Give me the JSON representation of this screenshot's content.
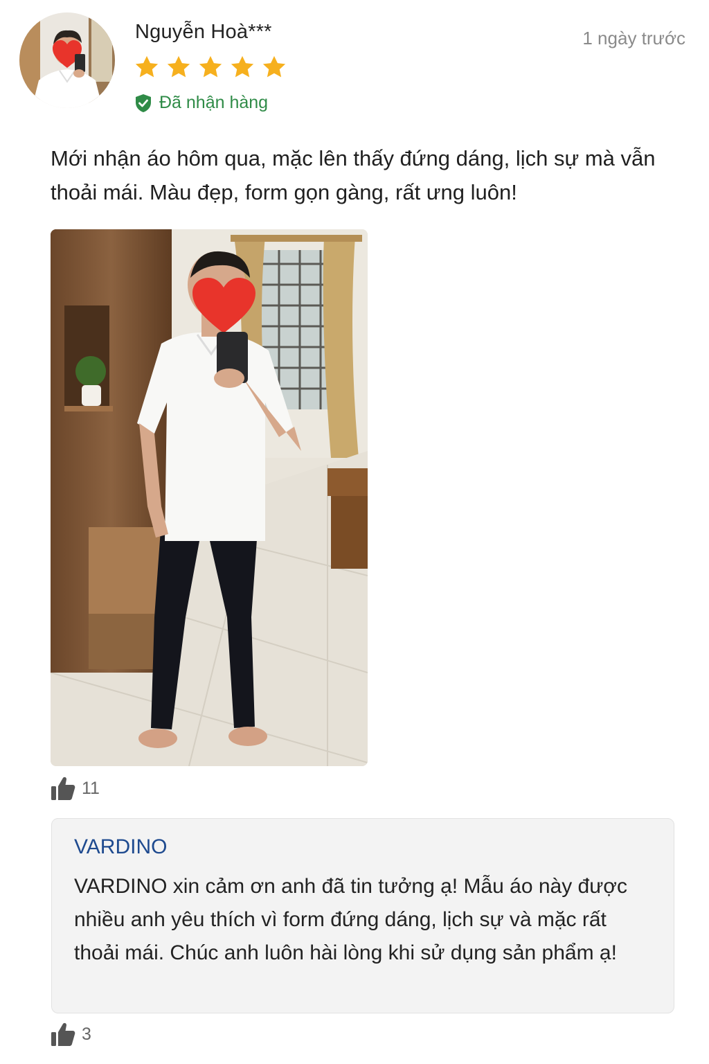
{
  "review": {
    "reviewer_name": "Nguyễn Hoà***",
    "time_ago": "1 ngày trước",
    "rating": 5,
    "rating_max": 5,
    "verified_label": "Đã nhận hàng",
    "text": "Mới nhận áo hôm qua, mặc lên thấy đứng dáng, lịch sự mà vẫn thoải mái. Màu đẹp, form gọn gàng, rất ưng luôn!",
    "like_count": "11"
  },
  "reply": {
    "seller_name": "VARDINO",
    "text": "VARDINO xin cảm ơn anh đã tin tưởng ạ! Mẫu áo này được nhiều anh yêu thích vì form đứng dáng, lịch sự và mặc rất thoải mái. Chúc anh luôn hài lòng khi sử dụng sản phẩm ạ!",
    "like_count": "3"
  },
  "colors": {
    "star": "#f6b01e",
    "verified_green": "#2f8b47",
    "seller_blue": "#1e4a8f",
    "time_gray": "#8a8a8a",
    "reply_bg": "#f3f3f3"
  },
  "icons": {
    "star": "star-icon",
    "verified": "shield-check-icon",
    "like": "thumbs-up-icon"
  }
}
